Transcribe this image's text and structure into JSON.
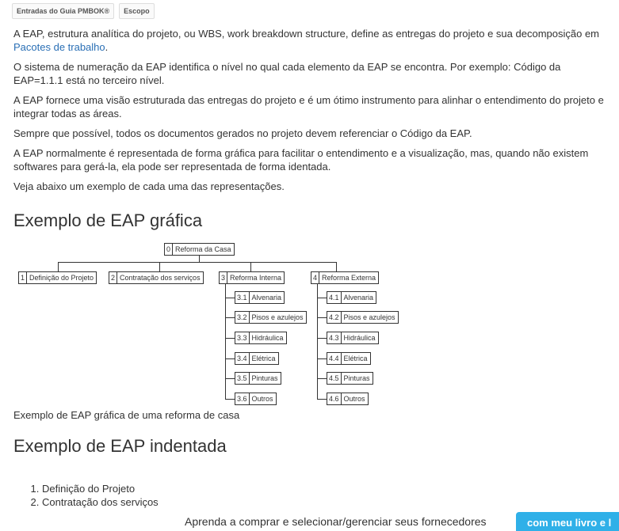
{
  "tags": [
    "Entradas do Guia PMBOK®",
    "Escopo"
  ],
  "paragraphs": {
    "p1_text": "A EAP, estrutura analítica do projeto, ou WBS, work breakdown structure, define as entregas do projeto e sua decomposição em ",
    "p1_link": "Pacotes de trabalho",
    "p1_end": ".",
    "p2": "O sistema de numeração da EAP identifica o nível no qual cada elemento da EAP se encontra. Por exemplo: Código da EAP=1.1.1 está no terceiro nível.",
    "p3": "A EAP fornece uma visão estruturada das entregas do projeto e é um ótimo instrumento para alinhar o entendimento do projeto e integrar todas as áreas.",
    "p4": "Sempre que possível, todos os documentos gerados no projeto devem referenciar o Código da EAP.",
    "p5": "A EAP normalmente é representada de forma gráfica para facilitar o entendimento e a visualização, mas, quando não existem softwares para gerá-la, ela pode ser representada de forma identada.",
    "p6": "Veja abaixo um exemplo de cada uma das representações."
  },
  "heading_grafica": "Exemplo de EAP gráfica",
  "wbs": {
    "root": {
      "num": "0",
      "label": "Reforma da Casa"
    },
    "level1": [
      {
        "num": "1",
        "label": "Definição do Projeto"
      },
      {
        "num": "2",
        "label": "Contratação dos serviços"
      },
      {
        "num": "3",
        "label": "Reforma Interna"
      },
      {
        "num": "4",
        "label": "Reforma Externa"
      }
    ],
    "interna": [
      {
        "num": "3.1",
        "label": "Alvenaria"
      },
      {
        "num": "3.2",
        "label": "Pisos e azulejos"
      },
      {
        "num": "3.3",
        "label": "Hidráulica"
      },
      {
        "num": "3.4",
        "label": "Elétrica"
      },
      {
        "num": "3.5",
        "label": "Pinturas"
      },
      {
        "num": "3.6",
        "label": "Outros"
      }
    ],
    "externa": [
      {
        "num": "4.1",
        "label": "Alvenaria"
      },
      {
        "num": "4.2",
        "label": "Pisos e azulejos"
      },
      {
        "num": "4.3",
        "label": "Hidráulica"
      },
      {
        "num": "4.4",
        "label": "Elétrica"
      },
      {
        "num": "4.5",
        "label": "Pinturas"
      },
      {
        "num": "4.6",
        "label": "Outros"
      }
    ]
  },
  "caption": "Exemplo de EAP gráfica de uma reforma de casa",
  "heading_indentada": "Exemplo de EAP indentada",
  "indented_list": [
    "Definição do Projeto",
    "Contratação dos serviços"
  ],
  "bottom_text": "Aprenda a comprar e selecionar/gerenciar seus fornecedores",
  "cta_label": "com meu livro e l"
}
